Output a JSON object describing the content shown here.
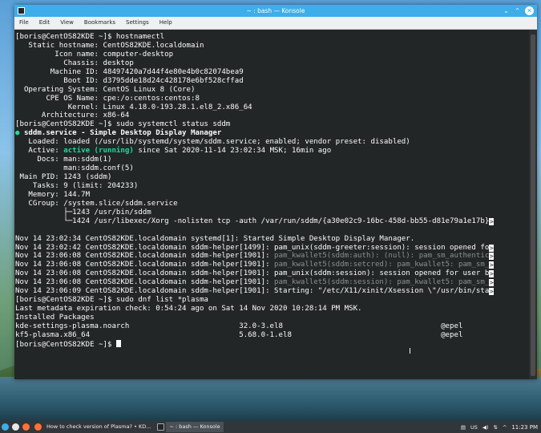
{
  "window": {
    "title": "~ : bash — Konsole",
    "controls": {
      "minimize": "⌄",
      "maximize": "⌃",
      "close": "✕"
    }
  },
  "menu": [
    "File",
    "Edit",
    "View",
    "Bookmarks",
    "Settings",
    "Help"
  ],
  "terminal": {
    "lines": [
      "[boris@CentOS82KDE ~]$ hostnamectl",
      "   Static hostname: CentOS82KDE.localdomain",
      "         Icon name: computer-desktop",
      "           Chassis: desktop",
      "        Machine ID: 48497420a7d44f4e80e4b0c82074bea9",
      "           Boot ID: d3795dde18d24c428178e6bf528cffad",
      "  Operating System: CentOS Linux 8 (Core)",
      "       CPE OS Name: cpe:/o:centos:centos:8",
      "            Kernel: Linux 4.18.0-193.28.1.el8_2.x86_64",
      "      Architecture: x86-64",
      "[boris@CentOS82KDE ~]$ sudo systemctl status sddm"
    ],
    "status_header_bullet": "●",
    "status_header": " sddm.service - Simple Desktop Display Manager",
    "loaded_line": "   Loaded: loaded (/usr/lib/systemd/system/sddm.service; enabled; vendor preset: disabled)",
    "active_prefix": "   Active: ",
    "active_state": "active (running)",
    "active_suffix": " since Sat 2020-11-14 23:02:34 MSK; 16min ago",
    "detail_lines": [
      "     Docs: man:sddm(1)",
      "           man:sddm.conf(5)",
      " Main PID: 1243 (sddm)",
      "    Tasks: 9 (limit: 204233)",
      "   Memory: 144.7M",
      "   CGroup: /system.slice/sddm.service",
      "           ├─1243 /usr/bin/sddm",
      "           └─1424 /usr/libexec/Xorg -nolisten tcp -auth /var/run/sddm/{a30e02c9-16bc-458d-bb55-d81e79a1e17b}"
    ],
    "log_lines": [
      {
        "prefix": "Nov 14 23:02:34 CentOS82KDE.localdomain systemd[1]: Started Simple Desktop Display Manager.",
        "msg": "",
        "grey": false,
        "trunc": false
      },
      {
        "prefix": "Nov 14 23:02:42 CentOS82KDE.localdomain sddm-helper[1499]: ",
        "msg": "pam_unix(sddm-greeter:session): session opened fo",
        "grey": false,
        "trunc": true
      },
      {
        "prefix": "Nov 14 23:06:08 CentOS82KDE.localdomain sddm-helper[1901]: ",
        "msg": "pam_kwallet5(sddm:auth): (null): pam_sm_authentic",
        "grey": true,
        "trunc": true
      },
      {
        "prefix": "Nov 14 23:06:08 CentOS82KDE.localdomain sddm-helper[1901]: ",
        "msg": "pam_kwallet5(sddm:setcred): pam_kwallet5: pam_sm_",
        "grey": true,
        "trunc": true
      },
      {
        "prefix": "Nov 14 23:06:08 CentOS82KDE.localdomain sddm-helper[1901]: ",
        "msg": "pam_unix(sddm:session): session opened for user b",
        "grey": false,
        "trunc": true
      },
      {
        "prefix": "Nov 14 23:06:08 CentOS82KDE.localdomain sddm-helper[1901]: ",
        "msg": "pam_kwallet5(sddm:session): pam_kwallet5: pam_sm_",
        "grey": true,
        "trunc": true
      },
      {
        "prefix": "Nov 14 23:06:09 CentOS82KDE.localdomain sddm-helper[1901]: ",
        "msg": "Starting: \"/etc/X11/xinit/Xsession \\\"/usr/bin/sta",
        "grey": false,
        "trunc": true
      }
    ],
    "dnf_lines": [
      "[boris@CentOS82KDE ~]$ sudo dnf list *plasma",
      "Last metadata expiration check: 0:54:24 ago on Sat 14 Nov 2020 10:28:14 PM MSK.",
      "Installed Packages",
      "kde-settings-plasma.noarch                         32.0-3.el8                                    @epel",
      "kf5-plasma.x86_64                                  5.68.0-1.el8                                  @epel"
    ],
    "prompt": "[boris@CentOS82KDE ~]$ ",
    "truncation_marker": ">"
  },
  "taskbar": {
    "tasks": [
      {
        "label": "How to check version of Plasma? • KD...",
        "active": false
      },
      {
        "label": "~ : bash — Konsole",
        "active": true
      }
    ],
    "keyboard_layout": "US",
    "clock": "11:23 PM",
    "tray_arrow": "^"
  },
  "colors": {
    "titlebar": "#3daee9",
    "terminal_bg": "#232627",
    "terminal_fg": "#fcfcfc",
    "status_green": "#1cdc9a",
    "taskbar_bg": "#31363b"
  }
}
